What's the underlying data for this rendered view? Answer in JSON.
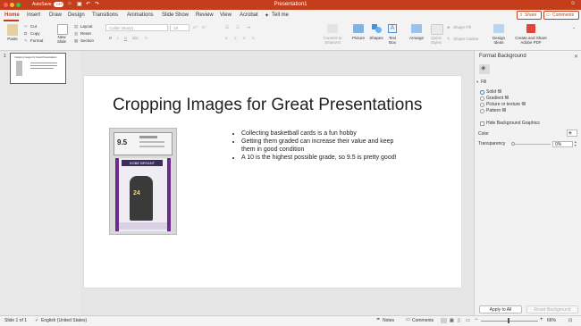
{
  "window": {
    "title": "Presentation1",
    "autosave_label": "AutoSave",
    "autosave_state": "OFF",
    "share_label": "Share",
    "comments_label": "Comments"
  },
  "tabs": [
    "Home",
    "Insert",
    "Draw",
    "Design",
    "Transitions",
    "Animations",
    "Slide Show",
    "Review",
    "View",
    "Acrobat",
    "Tell me"
  ],
  "active_tab": "Home",
  "ribbon": {
    "paste": "Paste",
    "cut": "Cut",
    "copy": "Copy",
    "format": "Format",
    "new_slide": "New\nSlide",
    "layout": "Layout",
    "reset": "Reset",
    "section": "Section",
    "font_name": "Calibri (Body)",
    "font_size": "18",
    "convert_smartart": "Convert to\nSmartArt",
    "picture": "Picture",
    "shapes": "Shapes",
    "text_box": "Text\nBox",
    "arrange": "Arrange",
    "quick_styles": "Quick\nStyles",
    "shape_fill": "Shape Fill",
    "shape_outline": "Shape Outline",
    "design_ideas": "Design\nIdeas",
    "create_share_pdf": "Create and Share\nAdobe PDF"
  },
  "thumbnail": {
    "number": "1",
    "title": "Cropping Images for Great Presentations"
  },
  "slide": {
    "title": "Cropping Images for Great Presentations",
    "bullets": [
      "Collecting basketball cards is a fun hobby",
      "Getting them graded can increase their value and keep them in good condition",
      "A 10 is the highest possible grade, so 9.5 is pretty good!"
    ],
    "card_grade": "9.5",
    "card_player": "KOBE BRYANT",
    "card_number": "24"
  },
  "format_pane": {
    "title": "Format Background",
    "section": "Fill",
    "options": [
      "Solid fill",
      "Gradient fill",
      "Picture or texture fill",
      "Pattern fill"
    ],
    "selected_option": "Solid fill",
    "hide_graphics": "Hide Background Graphics",
    "color_label": "Color",
    "transparency_label": "Transparency",
    "transparency_value": "0%",
    "apply_all": "Apply to All",
    "reset_background": "Reset Background"
  },
  "status": {
    "slide_info": "Slide 1 of 1",
    "language": "English (United States)",
    "notes": "Notes",
    "comments": "Comments",
    "zoom": "66%"
  },
  "colors": {
    "accent": "#c43e1c",
    "select_blue": "#2f7de1"
  }
}
